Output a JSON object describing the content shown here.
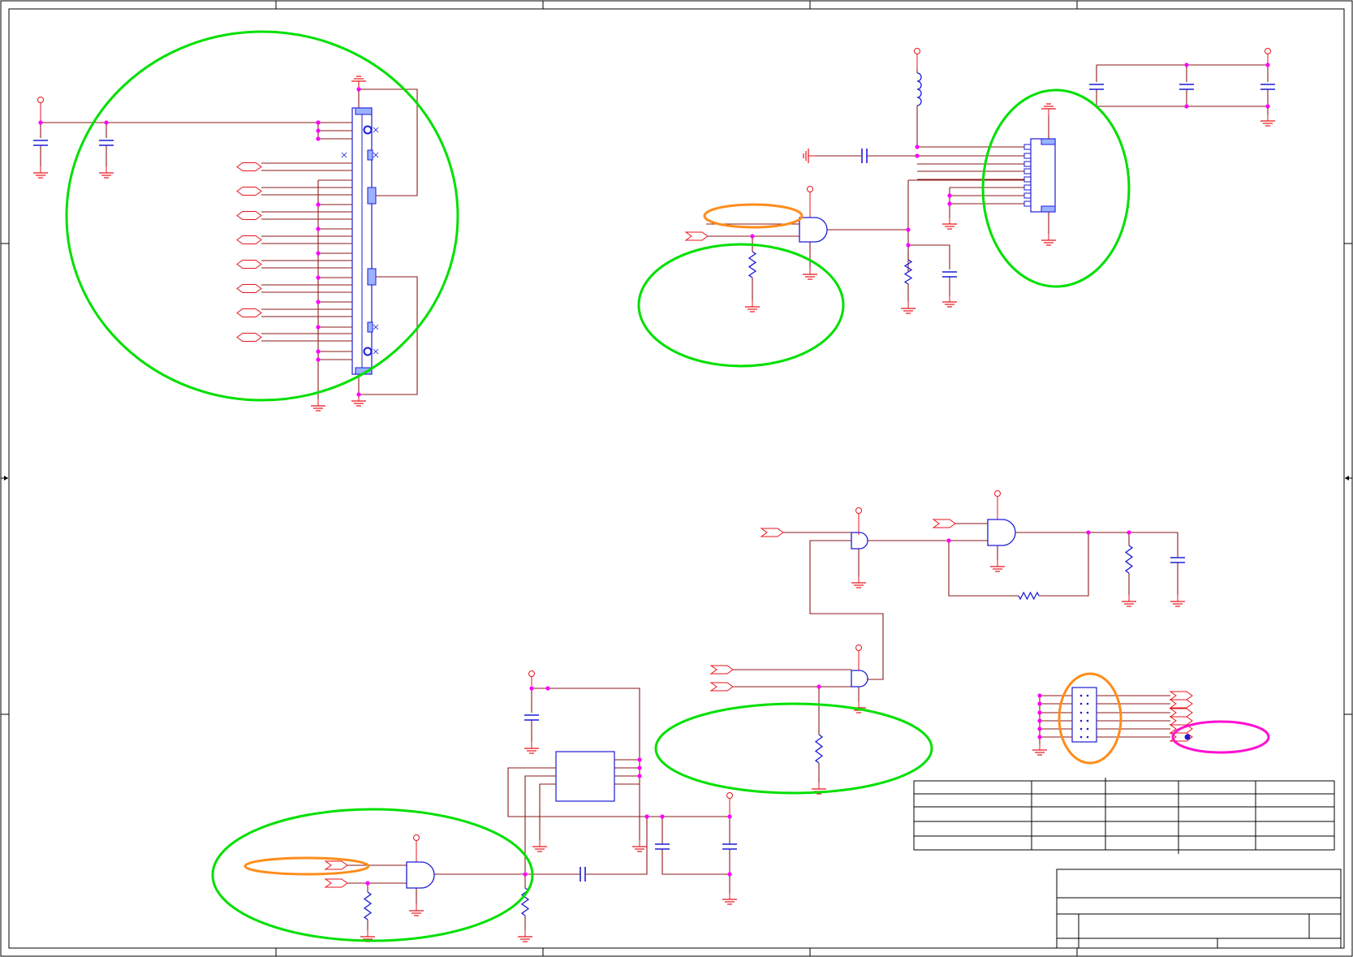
{
  "sheet": {
    "kind": "electrical schematic",
    "text_labels": []
  },
  "colors": {
    "wire": "#8b1a1a",
    "symbol_red": "#e8141c",
    "component_blue": "#1c1cd6",
    "junction": "#ff00ff",
    "highlight_green": "#00e000",
    "highlight_orange": "#ff8c1a",
    "highlight_magenta": "#ff10d0",
    "frame": "#000000"
  },
  "highlights": [
    {
      "id": "connector-block",
      "color": "green"
    },
    {
      "id": "gate1-pulldown",
      "color": "green"
    },
    {
      "id": "gate1-input-a",
      "color": "orange"
    },
    {
      "id": "connector-10pin",
      "color": "green"
    },
    {
      "id": "gate4-pulldown",
      "color": "green"
    },
    {
      "id": "gate5-input-block",
      "color": "green"
    },
    {
      "id": "gate5-input-a",
      "color": "orange"
    },
    {
      "id": "dip-switch",
      "color": "orange"
    },
    {
      "id": "output-port",
      "color": "magenta"
    }
  ],
  "revision_table": {
    "rows": 4,
    "columns": 5,
    "cells": []
  },
  "title_block": {
    "title": "",
    "size": "",
    "document_number": "",
    "rev": "",
    "date": "",
    "sheet": ""
  }
}
